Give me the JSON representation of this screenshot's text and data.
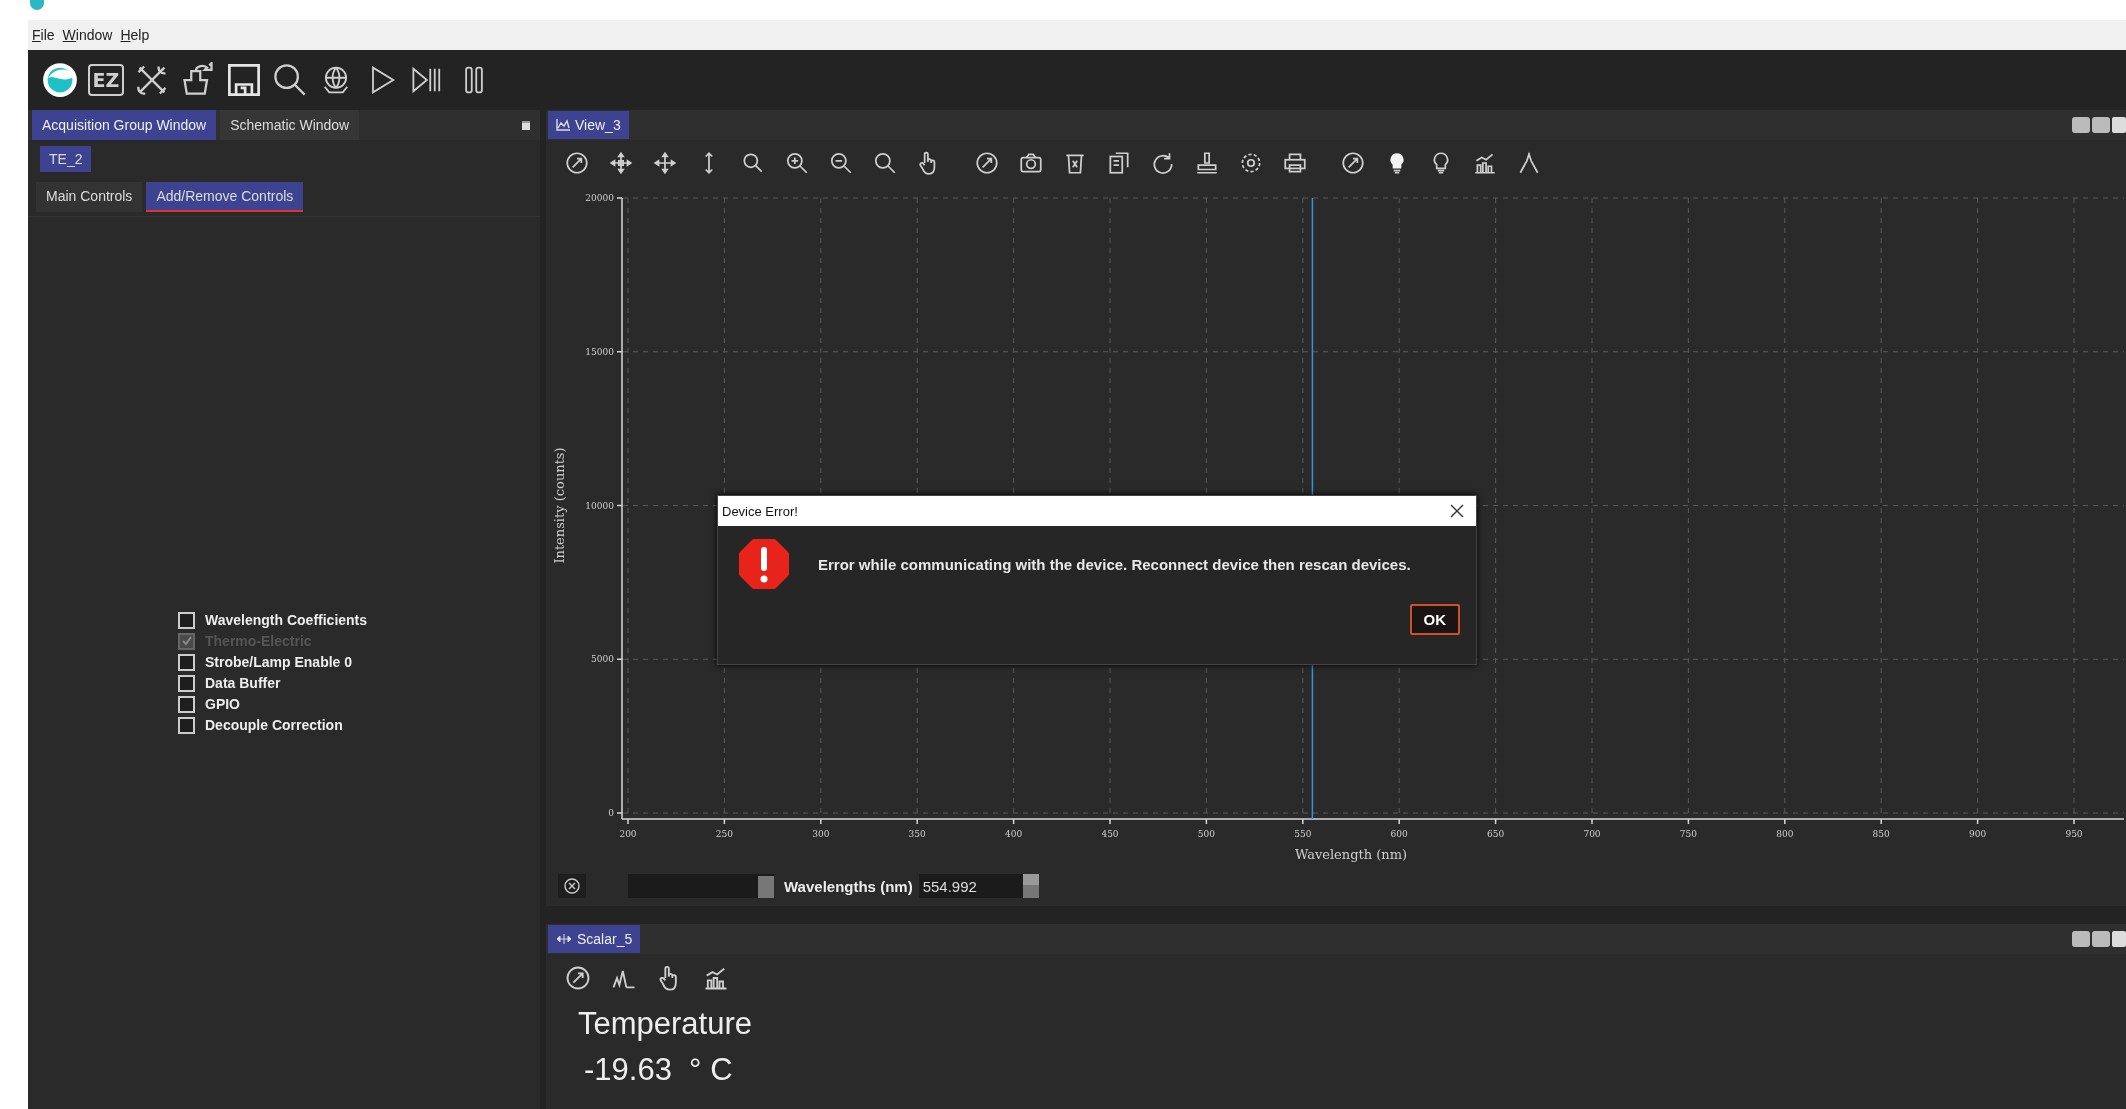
{
  "menu": [
    {
      "label": "File"
    },
    {
      "label": "Window"
    },
    {
      "label": "Help"
    }
  ],
  "toolbar": {
    "ez_label": "EZ"
  },
  "left_panel": {
    "tabs": [
      {
        "label": "Acquisition Group Window",
        "selected": true
      },
      {
        "label": "Schematic Window",
        "selected": false
      }
    ],
    "device_tabs": [
      {
        "label": "TE_2",
        "selected": true
      }
    ],
    "sub_tabs": [
      {
        "label": "Main Controls",
        "selected": false
      },
      {
        "label": "Add/Remove Controls",
        "selected": true
      }
    ],
    "controls": [
      {
        "label": "Wavelength Coefficients",
        "checked": false,
        "disabled": false
      },
      {
        "label": "Thermo-Electric",
        "checked": true,
        "disabled": true
      },
      {
        "label": "Strobe/Lamp Enable 0",
        "checked": false,
        "disabled": false
      },
      {
        "label": "Data Buffer",
        "checked": false,
        "disabled": false
      },
      {
        "label": "GPIO",
        "checked": false,
        "disabled": false
      },
      {
        "label": "Decouple Correction",
        "checked": false,
        "disabled": false
      }
    ]
  },
  "view": {
    "tab": "View_3",
    "chart_data": {
      "type": "line",
      "xlabel": "Wavelength (nm)",
      "ylabel": "Intensity (counts)",
      "xlim": [
        200,
        950
      ],
      "ylim": [
        0,
        20000
      ],
      "xticks": [
        200,
        250,
        300,
        350,
        400,
        450,
        500,
        550,
        600,
        650,
        700,
        750,
        800,
        850,
        900,
        950
      ],
      "yticks": [
        0,
        5000,
        10000,
        15000,
        20000
      ],
      "grid": true,
      "ref_lines": [
        {
          "axis": "x",
          "value": 554.992,
          "color": "#3d8fd6"
        }
      ]
    },
    "cursor": {
      "label": "Wavelengths (nm)",
      "value": "554.992"
    }
  },
  "scalar": {
    "tab": "Scalar_5",
    "name": "Temperature",
    "reading": "-19.63  ° C"
  },
  "dialog": {
    "title": "Device Error!",
    "message": "Error while communicating with the device. Reconnect device then rescan devices.",
    "button": "OK"
  }
}
